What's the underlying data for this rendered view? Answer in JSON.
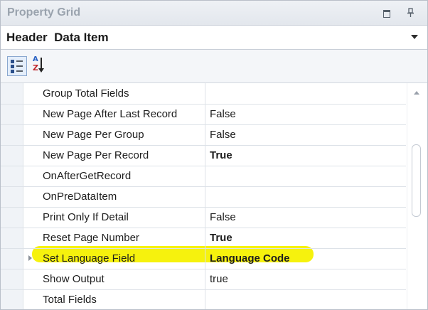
{
  "window": {
    "title": "Property Grid"
  },
  "selector": {
    "text": "Header  Data Item"
  },
  "toolbar": {
    "buttons": [
      "categorized-icon",
      "alphabetical-sort-icon"
    ]
  },
  "grid": {
    "rows": [
      {
        "name": "Group Total Fields",
        "value": "",
        "bold": false
      },
      {
        "name": "New Page After Last Record",
        "value": "False",
        "bold": false
      },
      {
        "name": "New Page Per Group",
        "value": "False",
        "bold": false
      },
      {
        "name": "New Page Per Record",
        "value": "True",
        "bold": true
      },
      {
        "name": "OnAfterGetRecord",
        "value": "",
        "bold": false
      },
      {
        "name": "OnPreDataItem",
        "value": "",
        "bold": false
      },
      {
        "name": "Print Only If Detail",
        "value": "False",
        "bold": false
      },
      {
        "name": "Reset Page Number",
        "value": "True",
        "bold": true
      },
      {
        "name": "Set Language Field",
        "value": "Language Code",
        "bold": true
      },
      {
        "name": "Show Output",
        "value": "true",
        "bold": false
      },
      {
        "name": "Total Fields",
        "value": "",
        "bold": false
      }
    ]
  },
  "colors": {
    "highlight": "#f6f100",
    "titleText": "#9aa3ae"
  }
}
